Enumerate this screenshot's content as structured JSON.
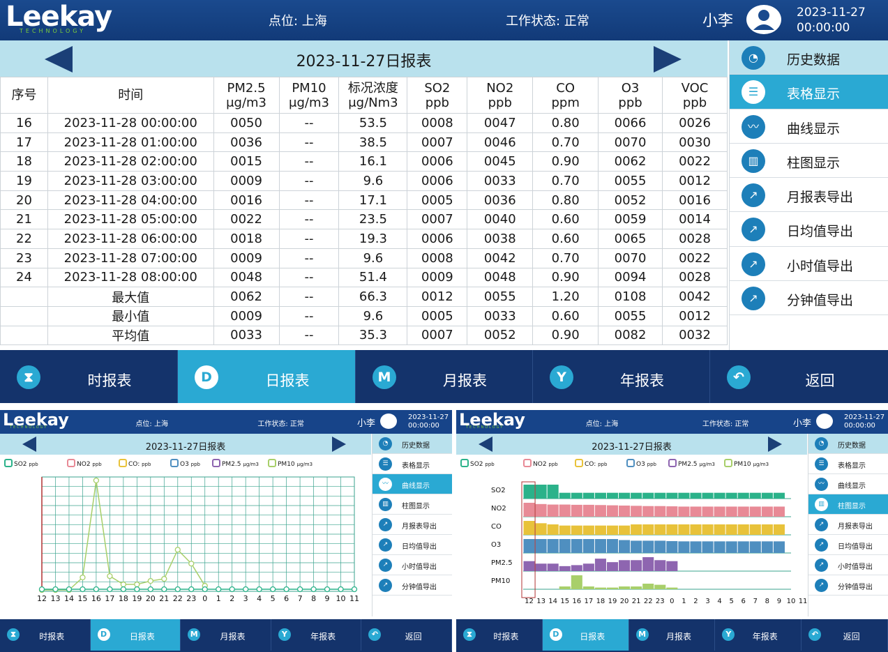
{
  "header": {
    "logo": "Leekay",
    "logo_sub": "TECHNOLOGY",
    "site": "点位: 上海",
    "status": "工作状态: 正常",
    "user": "小李",
    "date": "2023-11-27",
    "time": "00:00:00"
  },
  "report": {
    "title": "2023-11-27日报表"
  },
  "sidebar": {
    "items": [
      {
        "label": "历史数据",
        "icon": "history-icon"
      },
      {
        "label": "表格显示",
        "icon": "list-icon"
      },
      {
        "label": "曲线显示",
        "icon": "curve-icon"
      },
      {
        "label": "柱图显示",
        "icon": "bar-chart-icon"
      },
      {
        "label": "月报表导出",
        "icon": "export-icon"
      },
      {
        "label": "日均值导出",
        "icon": "export-icon"
      },
      {
        "label": "小时值导出",
        "icon": "export-icon"
      },
      {
        "label": "分钟值导出",
        "icon": "export-icon"
      }
    ]
  },
  "table": {
    "headers": [
      {
        "name": "序号",
        "unit": ""
      },
      {
        "name": "时间",
        "unit": ""
      },
      {
        "name": "PM2.5",
        "unit": "μg/m3"
      },
      {
        "name": "PM10",
        "unit": "μg/m3"
      },
      {
        "name": "标况浓度",
        "unit": "μg/Nm3"
      },
      {
        "name": "SO2",
        "unit": "ppb"
      },
      {
        "name": "NO2",
        "unit": "ppb"
      },
      {
        "name": "CO",
        "unit": "ppm"
      },
      {
        "name": "O3",
        "unit": "ppb"
      },
      {
        "name": "VOC",
        "unit": "ppb"
      }
    ],
    "rows": [
      [
        "16",
        "2023-11-28 00:00:00",
        "0050",
        "--",
        "53.5",
        "0008",
        "0047",
        "0.80",
        "0066",
        "0026"
      ],
      [
        "17",
        "2023-11-28 01:00:00",
        "0036",
        "--",
        "38.5",
        "0007",
        "0046",
        "0.70",
        "0070",
        "0030"
      ],
      [
        "18",
        "2023-11-28 02:00:00",
        "0015",
        "--",
        "16.1",
        "0006",
        "0045",
        "0.90",
        "0062",
        "0022"
      ],
      [
        "19",
        "2023-11-28 03:00:00",
        "0009",
        "--",
        "9.6",
        "0006",
        "0033",
        "0.70",
        "0055",
        "0012"
      ],
      [
        "20",
        "2023-11-28 04:00:00",
        "0016",
        "--",
        "17.1",
        "0005",
        "0036",
        "0.80",
        "0052",
        "0016"
      ],
      [
        "21",
        "2023-11-28 05:00:00",
        "0022",
        "--",
        "23.5",
        "0007",
        "0040",
        "0.60",
        "0059",
        "0014"
      ],
      [
        "22",
        "2023-11-28 06:00:00",
        "0018",
        "--",
        "19.3",
        "0006",
        "0038",
        "0.60",
        "0065",
        "0028"
      ],
      [
        "23",
        "2023-11-28 07:00:00",
        "0009",
        "--",
        "9.6",
        "0008",
        "0042",
        "0.70",
        "0070",
        "0022"
      ],
      [
        "24",
        "2023-11-28 08:00:00",
        "0048",
        "--",
        "51.4",
        "0009",
        "0048",
        "0.90",
        "0094",
        "0028"
      ]
    ],
    "stats": [
      [
        "最大值",
        "0062",
        "--",
        "66.3",
        "0012",
        "0055",
        "1.20",
        "0108",
        "0042"
      ],
      [
        "最小值",
        "0009",
        "--",
        "9.6",
        "0005",
        "0033",
        "0.60",
        "0055",
        "0012"
      ],
      [
        "平均值",
        "0033",
        "--",
        "35.3",
        "0007",
        "0052",
        "0.90",
        "0082",
        "0032"
      ]
    ]
  },
  "bottom_nav": [
    {
      "label": "时报表",
      "icon": "hourglass-icon"
    },
    {
      "label": "日报表",
      "icon": "D"
    },
    {
      "label": "月报表",
      "icon": "M"
    },
    {
      "label": "年报表",
      "icon": "Y"
    },
    {
      "label": "返回",
      "icon": "back-icon"
    }
  ],
  "legend": [
    {
      "name": "SO2",
      "unit": "ppb",
      "color": "#2bb28a"
    },
    {
      "name": "NO2",
      "unit": "ppb",
      "color": "#e88a96"
    },
    {
      "name": "CO:",
      "unit": "ppb",
      "color": "#e8c23a"
    },
    {
      "name": "O3",
      "unit": "ppb",
      "color": "#4f8fc0"
    },
    {
      "name": "PM2.5",
      "unit": "μg/m3",
      "color": "#8e65b0"
    },
    {
      "name": "PM10",
      "unit": "μg/m3",
      "color": "#a8cf6a"
    }
  ],
  "chart_data": [
    {
      "type": "line",
      "x": [
        "12",
        "13",
        "14",
        "15",
        "16",
        "17",
        "18",
        "19",
        "20",
        "21",
        "22",
        "23",
        "0",
        "1",
        "2",
        "3",
        "4",
        "5",
        "6",
        "7",
        "8",
        "9",
        "10",
        "11"
      ],
      "series": [
        {
          "name": "PM10",
          "values": [
            2,
            2,
            2,
            20,
            160,
            22,
            10,
            10,
            15,
            18,
            60,
            40,
            8,
            null,
            null,
            null,
            null,
            null,
            null,
            null,
            null,
            null,
            null,
            null
          ]
        },
        {
          "name": "SO2",
          "values": [
            3,
            3,
            3,
            3,
            3,
            3,
            3,
            3,
            3,
            3,
            3,
            3,
            3,
            3,
            3,
            3,
            3,
            3,
            3,
            3,
            3,
            3,
            3,
            3
          ]
        }
      ]
    },
    {
      "type": "bar",
      "x": [
        "12",
        "13",
        "14",
        "15",
        "16",
        "17",
        "18",
        "19",
        "20",
        "21",
        "22",
        "23",
        "0",
        "1",
        "2",
        "3",
        "4",
        "5",
        "6",
        "7",
        "8",
        "9",
        "10",
        "11"
      ],
      "series": [
        {
          "name": "SO2",
          "values": [
            12,
            12,
            12,
            5,
            5,
            5,
            5,
            5,
            5,
            5,
            5,
            5,
            5,
            5,
            5,
            5,
            5,
            5,
            5,
            5,
            5,
            5
          ]
        },
        {
          "name": "NO2",
          "values": [
            55,
            50,
            48,
            48,
            47,
            47,
            46,
            45,
            44,
            43,
            42,
            42,
            41,
            40,
            40,
            40,
            40,
            40,
            40,
            40,
            40,
            40
          ]
        },
        {
          "name": "CO",
          "values": [
            1.2,
            1.0,
            0.9,
            0.8,
            0.8,
            0.8,
            0.8,
            0.8,
            0.8,
            0.9,
            0.9,
            0.9,
            0.9,
            0.9,
            0.9,
            0.9,
            0.9,
            0.9,
            0.9,
            0.9,
            0.9,
            0.9
          ]
        },
        {
          "name": "O3",
          "values": [
            108,
            108,
            108,
            108,
            108,
            108,
            108,
            108,
            100,
            95,
            95,
            95,
            92,
            90,
            90,
            90,
            90,
            90,
            90,
            90,
            90,
            90
          ]
        },
        {
          "name": "PM2.5",
          "values": [
            20,
            15,
            15,
            10,
            12,
            15,
            25,
            18,
            22,
            22,
            28,
            22,
            20
          ]
        },
        {
          "name": "PM10",
          "values": [
            0,
            0,
            0,
            5,
            25,
            5,
            3,
            3,
            5,
            5,
            10,
            8,
            3
          ]
        }
      ]
    }
  ]
}
